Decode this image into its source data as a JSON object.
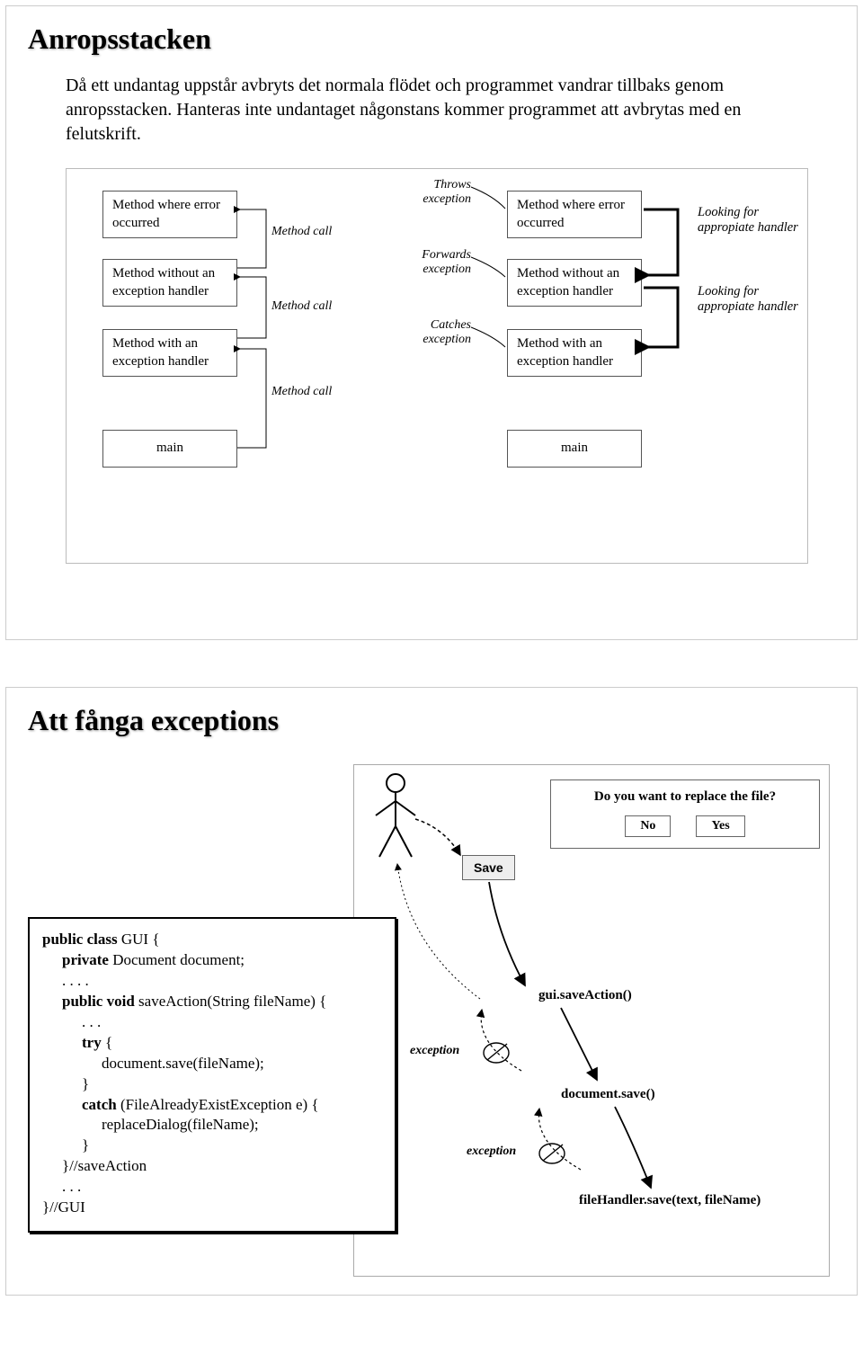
{
  "slide1": {
    "title": "Anropsstacken",
    "body": "Då ett undantag uppstår avbryts det normala flödet och programmet vandrar tillbaks genom anropsstacken. Hanteras inte undantaget någonstans kommer programmet att avbrytas med en felutskrift.",
    "left_boxes": {
      "b1": "Method where error occurred",
      "b2": "Method without an exception handler",
      "b3": "Method with an exception handler",
      "b4": "main"
    },
    "method_call": "Method call",
    "right_labels": {
      "l1": "Throws exception",
      "l2": "Forwards exception",
      "l3": "Catches exception"
    },
    "right_boxes": {
      "b1": "Method where error occurred",
      "b2": "Method without an exception handler",
      "b3": "Method with an exception handler",
      "b4": "main"
    },
    "looking": "Looking for appropiate handler"
  },
  "slide2": {
    "title": "Att fånga exceptions",
    "code": {
      "l1a": "public class",
      "l1b": " GUI {",
      "l2a": "private",
      "l2b": " Document document;",
      "l3": ". . . .",
      "l4a": "public void",
      "l4b": " saveAction(String fileName) {",
      "l5": ". . .",
      "l6a": "try",
      "l6b": " {",
      "l7": "document.save(fileName);",
      "l8": "}",
      "l9a": "catch",
      "l9b": " (FileAlreadyExistException e) {",
      "l10": "replaceDialog(fileName);",
      "l11": "}",
      "l12": "}//saveAction",
      "l13": ". . .",
      "l14": "}//GUI"
    },
    "dialog": {
      "title": "Do you want to replace the file?",
      "no": "No",
      "yes": "Yes"
    },
    "save": "Save",
    "calls": {
      "c1": "gui.saveAction()",
      "c2": "document.save()",
      "c3": "fileHandler.save(text, fileName)"
    },
    "exception": "exception"
  }
}
